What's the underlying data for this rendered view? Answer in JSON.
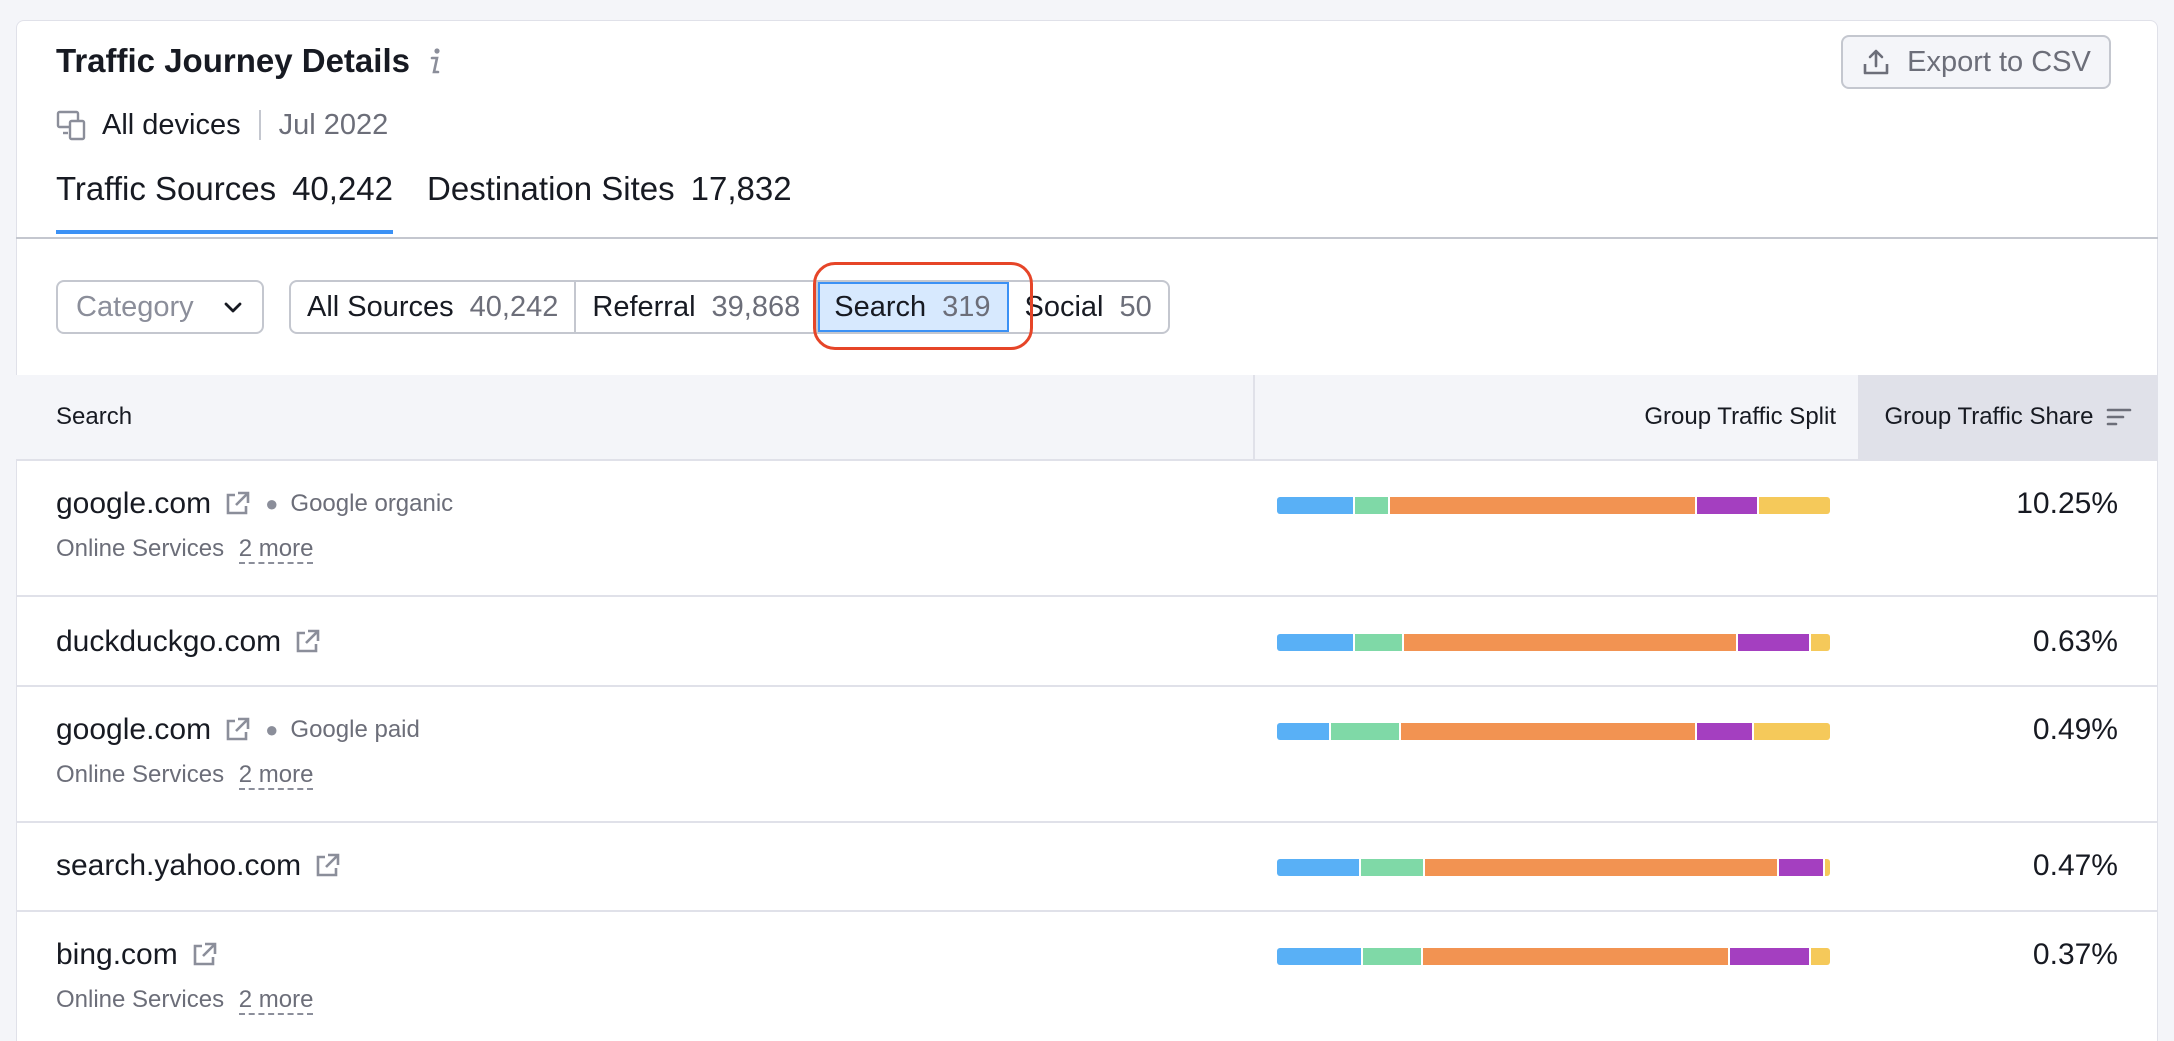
{
  "header": {
    "title": "Traffic Journey Details",
    "export_label": "Export to CSV",
    "device": "All devices",
    "date": "Jul 2022"
  },
  "tabs": [
    {
      "label": "Traffic Sources",
      "count": "40,242"
    },
    {
      "label": "Destination Sites",
      "count": "17,832"
    }
  ],
  "filters": {
    "category_placeholder": "Category",
    "groups": [
      {
        "label": "All Sources",
        "count": "40,242"
      },
      {
        "label": "Referral",
        "count": "39,868"
      },
      {
        "label": "Search",
        "count": "319"
      },
      {
        "label": "Social",
        "count": "50"
      }
    ],
    "selected": "Search"
  },
  "table": {
    "headers": {
      "name": "Search",
      "split": "Group Traffic Split",
      "share": "Group Traffic Share"
    },
    "split_colors": [
      "#59b0f6",
      "#7fd9a7",
      "#f29352",
      "#a43fc0",
      "#f5c95a"
    ],
    "rows": [
      {
        "domain": "google.com",
        "source_type": "Google organic",
        "category": "Online Services",
        "more": "2 more",
        "share": "10.25%",
        "split": [
          14,
          6,
          56,
          11,
          13
        ]
      },
      {
        "domain": "duckduckgo.com",
        "source_type": "",
        "category": "",
        "more": "",
        "share": "0.63%",
        "split": [
          14,
          8.5,
          61,
          13,
          3.5
        ]
      },
      {
        "domain": "google.com",
        "source_type": "Google paid",
        "category": "Online Services",
        "more": "2 more",
        "share": "0.49%",
        "split": [
          9.5,
          12.5,
          54,
          10,
          14
        ]
      },
      {
        "domain": "search.yahoo.com",
        "source_type": "",
        "category": "",
        "more": "",
        "share": "0.47%",
        "split": [
          15,
          11.5,
          64.5,
          8,
          1
        ]
      },
      {
        "domain": "bing.com",
        "source_type": "",
        "category": "Online Services",
        "more": "2 more",
        "share": "0.37%",
        "split": [
          15.5,
          10.5,
          56,
          14.5,
          3.5
        ]
      }
    ]
  }
}
